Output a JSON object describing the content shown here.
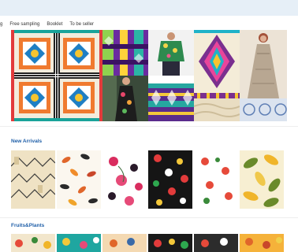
{
  "nav": {
    "items": [
      "g",
      "Free sampling",
      "Booklet",
      "To be seller"
    ]
  },
  "sections": {
    "new_arrivals": {
      "title": "New Arrivals"
    },
    "fruits_plants": {
      "title": "Fruits&Plants"
    }
  },
  "banner": {
    "tiles": [
      "geometric-pattern",
      "purple-ikat-fabric",
      "floral-shirt-model",
      "aztec-pattern",
      "maxi-dress-model",
      "dress-model",
      "blue-ikat-fabric",
      "tan-texture",
      "blue-damask"
    ]
  },
  "new_arrivals_cards": [
    "cream-mountain-print",
    "autumn-leaves-print",
    "pink-floral-print",
    "dark-floral-print",
    "white-rose-print",
    "tropical-leaves-print"
  ],
  "fruits_plants_cards": [
    "fruit-print-1",
    "fruit-print-2",
    "fruit-print-3",
    "fruit-print-4",
    "fruit-print-5",
    "fruit-print-6"
  ]
}
